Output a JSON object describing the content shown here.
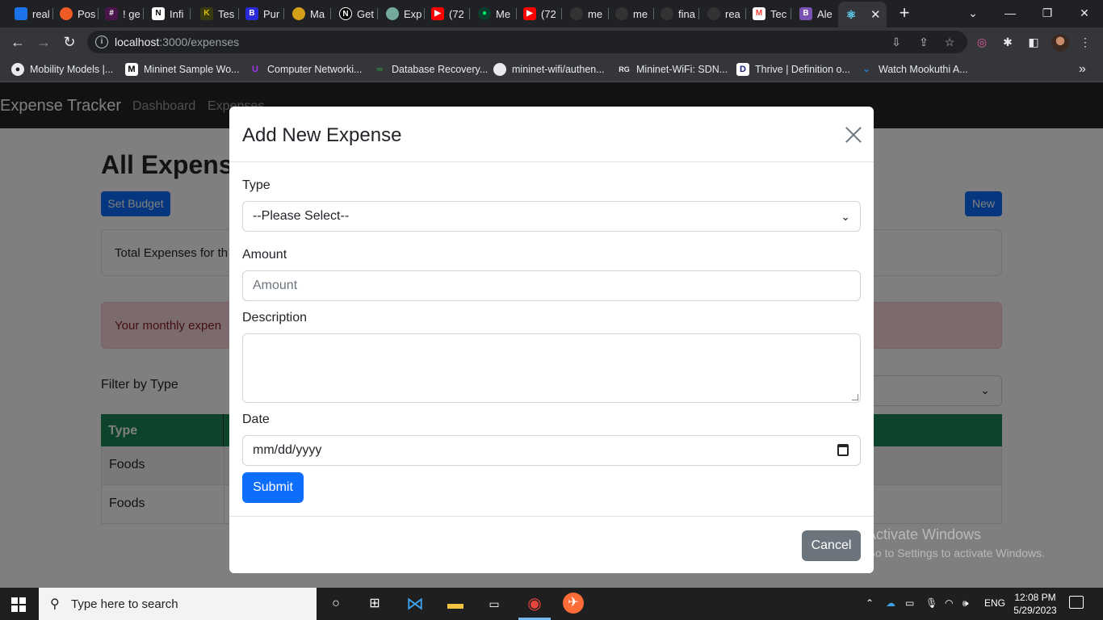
{
  "browser": {
    "tabs": [
      {
        "title": "real",
        "icon": "tab-icon",
        "color": "#1a73e8"
      },
      {
        "title": "Pos",
        "icon": "postman-icon",
        "color": "#ef5b25"
      },
      {
        "title": "! ge",
        "icon": "slack-icon",
        "color": "#4a154b"
      },
      {
        "title": "Infi",
        "icon": "notion-icon",
        "color": "#ffffff"
      },
      {
        "title": "Tes",
        "icon": "tab-icon",
        "color": "#c9a400"
      },
      {
        "title": "Pur",
        "icon": "tab-icon",
        "color": "#2b2bd9"
      },
      {
        "title": "Ma",
        "icon": "tab-icon",
        "color": "#d4a017"
      },
      {
        "title": "Get",
        "icon": "nextjs-icon",
        "color": "#000000"
      },
      {
        "title": "Exp",
        "icon": "chatgpt-icon",
        "color": "#74aa9c"
      },
      {
        "title": "(72",
        "icon": "youtube-icon",
        "color": "#ff0000"
      },
      {
        "title": "Me",
        "icon": "mongodb-icon",
        "color": "#00ed64"
      },
      {
        "title": "(72",
        "icon": "youtube-icon",
        "color": "#ff0000"
      },
      {
        "title": "me",
        "icon": "github-icon",
        "color": "#333333"
      },
      {
        "title": "me",
        "icon": "github-icon",
        "color": "#333333"
      },
      {
        "title": "fina",
        "icon": "github-icon",
        "color": "#333333"
      },
      {
        "title": "rea",
        "icon": "github-icon",
        "color": "#333333"
      },
      {
        "title": "Tec",
        "icon": "gmail-icon",
        "color": "#ea4335"
      },
      {
        "title": "Ale",
        "icon": "bootstrap-icon",
        "color": "#7952b3"
      },
      {
        "title": "",
        "icon": "react-icon",
        "color": "#61dafb"
      }
    ],
    "url_host": "localhost",
    "url_path": ":3000/expenses",
    "bookmarks": [
      {
        "label": "Mobility Models |...",
        "icon": "bookmark-icon"
      },
      {
        "label": "Mininet Sample Wo...",
        "icon": "medium-icon"
      },
      {
        "label": "Computer Networki...",
        "icon": "udemy-icon"
      },
      {
        "label": "Database Recovery...",
        "icon": "gfg-icon"
      },
      {
        "label": "mininet-wifi/authen...",
        "icon": "github-icon"
      },
      {
        "label": "Mininet-WiFi: SDN...",
        "icon": "researchgate-icon"
      },
      {
        "label": "Thrive | Definition o...",
        "icon": "dictionary-icon"
      },
      {
        "label": "Watch Mookuthi A...",
        "icon": "hotstar-icon"
      }
    ],
    "more_bookmarks": "»"
  },
  "app": {
    "brand": "Expense Tracker",
    "nav": [
      "Dashboard",
      "Expenses"
    ],
    "page_title": "All Expenses",
    "set_budget_label": "Set Budget",
    "new_label": "New",
    "total_text": "Total Expenses for th",
    "alert_text": "Your monthly expen",
    "filter_label": "Filter by Type",
    "table": {
      "header": "Type",
      "rows": [
        "Foods",
        "Foods"
      ]
    }
  },
  "modal": {
    "title": "Add New Expense",
    "type_label": "Type",
    "type_value": "--Please Select--",
    "amount_label": "Amount",
    "amount_placeholder": "Amount",
    "description_label": "Description",
    "date_label": "Date",
    "date_placeholder": "mm/dd/yyyy",
    "submit_label": "Submit",
    "cancel_label": "Cancel"
  },
  "watermark": {
    "line1": "Activate Windows",
    "line2": "Go to Settings to activate Windows."
  },
  "taskbar": {
    "search_placeholder": "Type here to search",
    "language": "ENG",
    "time": "12:08 PM",
    "date": "5/29/2023"
  },
  "colors": {
    "primary": "#0d6efd",
    "secondary": "#6c757d",
    "table_header": "#198754",
    "navbar": "#212529",
    "alert_bg": "#f8d7da"
  }
}
